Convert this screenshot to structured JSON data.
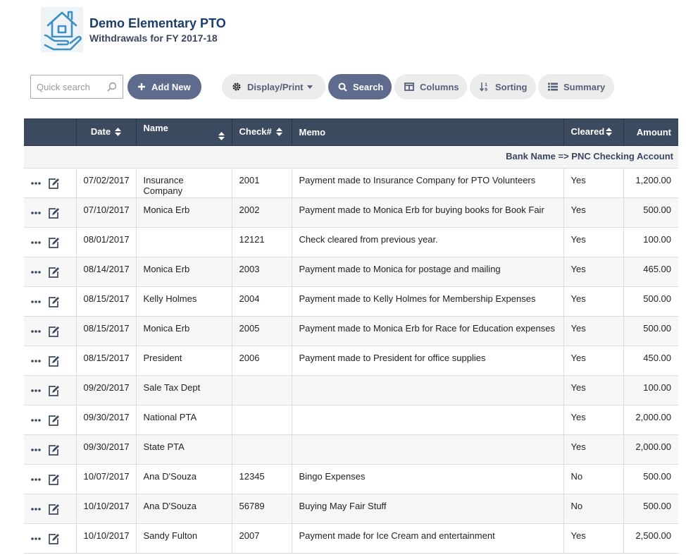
{
  "header": {
    "title": "Demo Elementary PTO",
    "subtitle": "Withdrawals for FY 2017-18"
  },
  "toolbar": {
    "search_placeholder": "Quick search",
    "add_new_label": "Add New",
    "display_print_label": "Display/Print",
    "search_label": "Search",
    "columns_label": "Columns",
    "sorting_label": "Sorting",
    "summary_label": "Summary"
  },
  "table": {
    "headers": {
      "date": "Date",
      "name": "Name",
      "check": "Check#",
      "memo": "Memo",
      "cleared": "Cleared",
      "amount": "Amount"
    },
    "group_label": "Bank Name => PNC Checking Account",
    "rows": [
      {
        "date": "07/02/2017",
        "name": "Insurance Company",
        "check": "2001",
        "memo": "Payment made to Insurance Company for PTO Volunteers",
        "cleared": "Yes",
        "amount": "1,200.00"
      },
      {
        "date": "07/10/2017",
        "name": "Monica Erb",
        "check": "2002",
        "memo": "Payment made to Monica Erb for buying books for Book Fair",
        "cleared": "Yes",
        "amount": "500.00"
      },
      {
        "date": "08/01/2017",
        "name": "",
        "check": "12121",
        "memo": "Check cleared from previous year.",
        "cleared": "Yes",
        "amount": "100.00"
      },
      {
        "date": "08/14/2017",
        "name": "Monica Erb",
        "check": "2003",
        "memo": "Payment made to Monica for postage and mailing",
        "cleared": "Yes",
        "amount": "465.00"
      },
      {
        "date": "08/15/2017",
        "name": "Kelly Holmes",
        "check": "2004",
        "memo": "Payment made to Kelly Holmes for Membership Expenses",
        "cleared": "Yes",
        "amount": "500.00"
      },
      {
        "date": "08/15/2017",
        "name": "Monica Erb",
        "check": "2005",
        "memo": "Payment made to Monica Erb for Race for Education expenses",
        "cleared": "Yes",
        "amount": "500.00"
      },
      {
        "date": "08/15/2017",
        "name": "President",
        "check": "2006",
        "memo": "Payment made to President for office supplies",
        "cleared": "Yes",
        "amount": "450.00"
      },
      {
        "date": "09/20/2017",
        "name": "Sale Tax Dept",
        "check": "",
        "memo": "",
        "cleared": "Yes",
        "amount": "100.00"
      },
      {
        "date": "09/30/2017",
        "name": "National PTA",
        "check": "",
        "memo": "",
        "cleared": "Yes",
        "amount": "2,000.00"
      },
      {
        "date": "09/30/2017",
        "name": "State PTA",
        "check": "",
        "memo": "",
        "cleared": "Yes",
        "amount": "2,000.00"
      },
      {
        "date": "10/07/2017",
        "name": "Ana D'Souza",
        "check": "12345",
        "memo": "Bingo Expenses",
        "cleared": "No",
        "amount": "500.00"
      },
      {
        "date": "10/10/2017",
        "name": "Ana D'Souza",
        "check": "56789",
        "memo": "Buying May Fair Stuff",
        "cleared": "No",
        "amount": "500.00"
      },
      {
        "date": "10/10/2017",
        "name": "Sandy Fulton",
        "check": "2007",
        "memo": "Payment made for Ice Cream and entertainment",
        "cleared": "Yes",
        "amount": "2,500.00"
      }
    ]
  },
  "colors": {
    "header_bg": "#3c4a60",
    "primary_button": "#5e6b8c",
    "title": "#1d3c6e"
  },
  "icons": {
    "logo": "house-in-hand-logo",
    "row_more": "more-dots-icon",
    "row_edit": "edit-icon"
  }
}
